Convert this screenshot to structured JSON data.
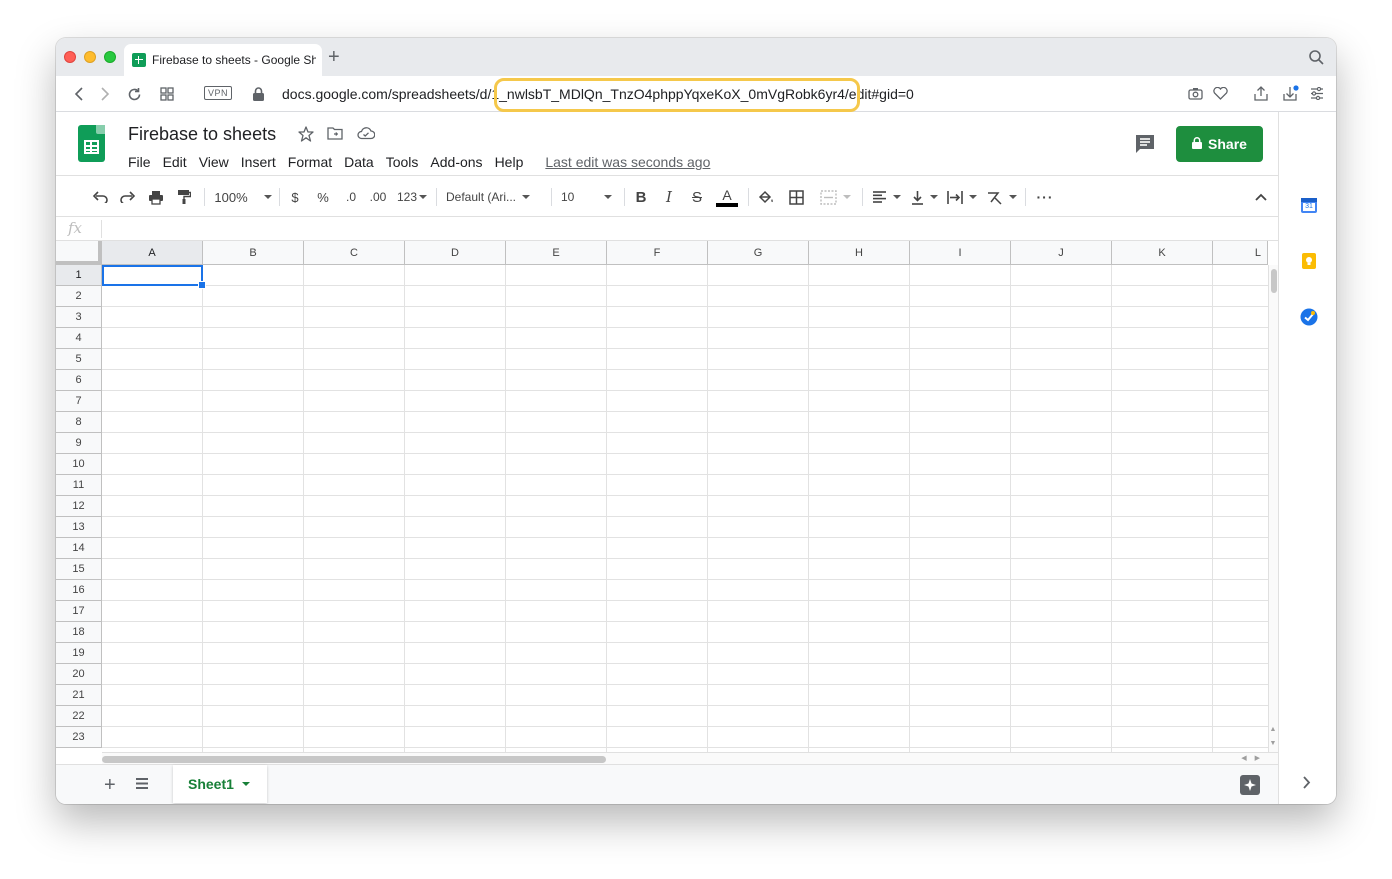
{
  "browser": {
    "tab_title": "Firebase to sheets - Google Sheets",
    "url": "docs.google.com/spreadsheets/d/1_nwlsbT_MDlQn_TnzO4phppYqxeKoX_0mVgRobk6yr4/edit#gid=0",
    "vpn_label": "VPN",
    "new_tab_label": "+"
  },
  "doc": {
    "title": "Firebase to sheets",
    "menu": [
      "File",
      "Edit",
      "View",
      "Insert",
      "Format",
      "Data",
      "Tools",
      "Add-ons",
      "Help"
    ],
    "last_edit": "Last edit was seconds ago",
    "share_label": "Share"
  },
  "toolbar": {
    "zoom": "100%",
    "currency": "$",
    "percent": "%",
    "decrease_decimal": ".0",
    "increase_decimal": ".00",
    "more_formats": "123",
    "font": "Default (Ari...",
    "font_size": "10",
    "bold": "B",
    "italic": "I",
    "strike": "S",
    "text_color_glyph": "A",
    "more": "···"
  },
  "formula_bar": {
    "fx_label": "fx",
    "value": ""
  },
  "grid": {
    "columns": [
      "A",
      "B",
      "C",
      "D",
      "E",
      "F",
      "G",
      "H",
      "I",
      "J",
      "K",
      "L"
    ],
    "rows": [
      "1",
      "2",
      "3",
      "4",
      "5",
      "6",
      "7",
      "8",
      "9",
      "10",
      "11",
      "12",
      "13",
      "14",
      "15",
      "16",
      "17",
      "18",
      "19",
      "20",
      "21",
      "22",
      "23"
    ],
    "selected_cell": "A1"
  },
  "sheets": {
    "add_label": "+",
    "tabs": [
      "Sheet1"
    ]
  },
  "colors": {
    "share_green": "#1e8e3e",
    "selection_blue": "#1a73e8",
    "sheet_tab_green": "#188038",
    "url_highlight": "#f5c84b"
  },
  "side_panel": {
    "calendar_day": "31",
    "icons": [
      "calendar-icon",
      "keep-icon",
      "tasks-icon"
    ]
  }
}
